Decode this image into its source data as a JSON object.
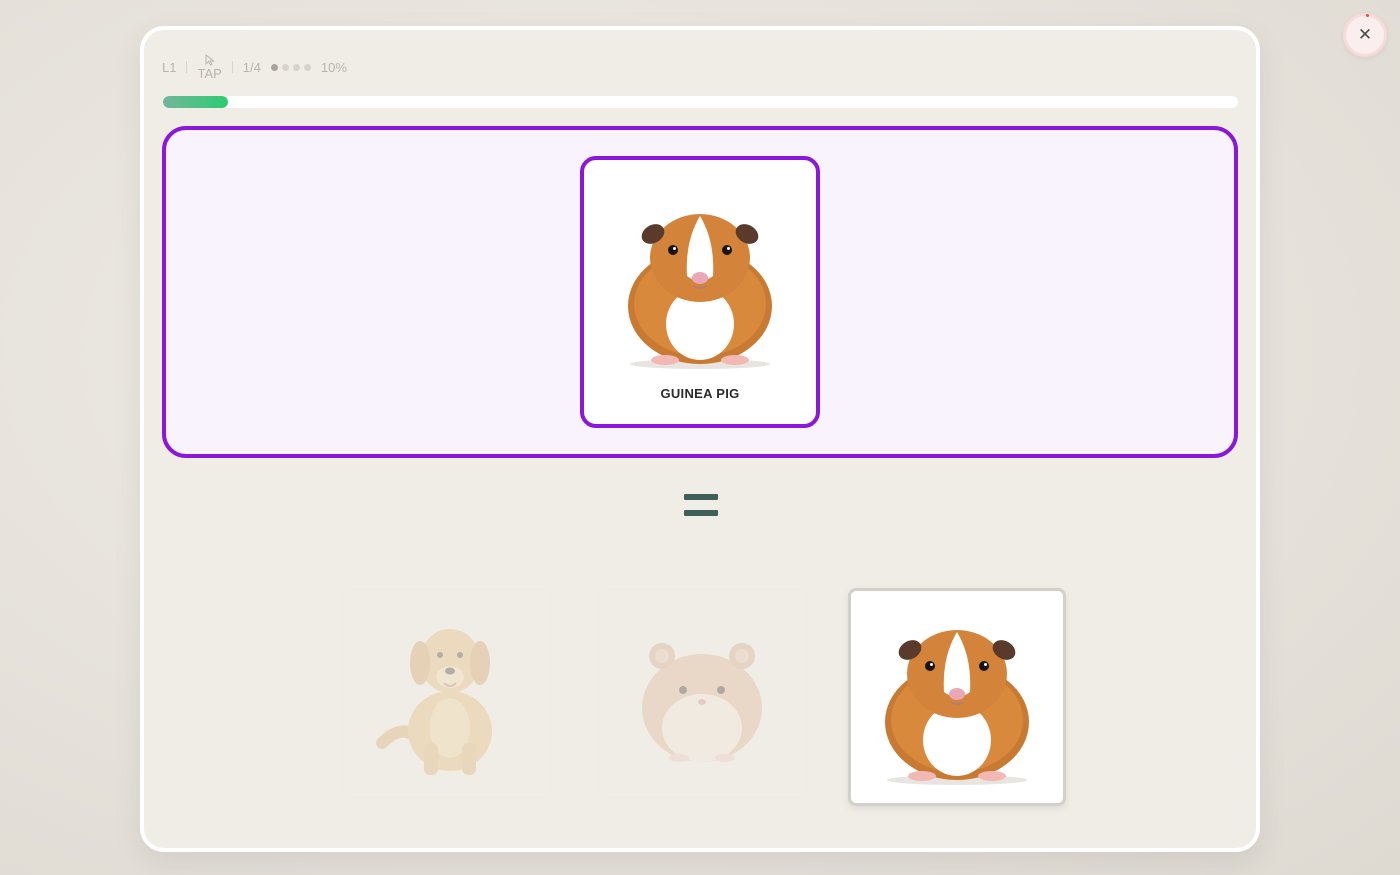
{
  "header": {
    "level": "L1",
    "mode": "TAP",
    "step": "1/4",
    "step_dots": [
      true,
      false,
      false,
      false
    ],
    "percent_text": "10%"
  },
  "progress": {
    "fraction": 0.06
  },
  "question": {
    "label": "GUINEA PIG",
    "image": "guinea-pig-image"
  },
  "equals_symbol": "=",
  "options": [
    {
      "image": "dog-image",
      "state": "dimmed"
    },
    {
      "image": "hamster-image",
      "state": "dimmed"
    },
    {
      "image": "guinea-pig-image",
      "state": "normal"
    }
  ],
  "colors": {
    "accent": "#8a17d9",
    "progress_start": "#73b59b",
    "progress_end": "#2ecc71",
    "equals": "#3f5f59"
  },
  "close": {
    "icon": "close-icon"
  }
}
